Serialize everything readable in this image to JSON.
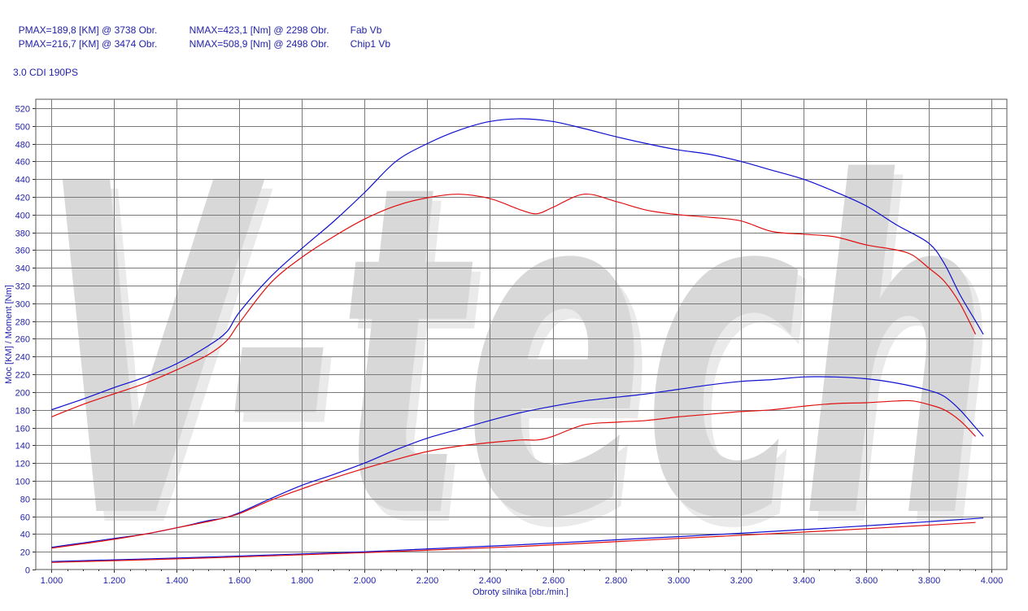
{
  "header": {
    "rows": [
      {
        "pmax": "PMAX=189,8 [KM] @ 3738 Obr.",
        "nmax": "NMAX=423,1 [Nm] @ 2298 Obr.",
        "name": "Fab Vb"
      },
      {
        "pmax": "PMAX=216,7 [KM] @ 3474 Obr.",
        "nmax": "NMAX=508,9 [Nm] @ 2498 Obr.",
        "name": "Chip1 Vb"
      }
    ],
    "title": "3.0 CDI 190PS"
  },
  "watermark": {
    "text": "V-tech"
  },
  "colors": {
    "fab": "#e01010",
    "chip": "#1010d0",
    "grid": "#7a7a7a",
    "text": "#1f1fa8"
  },
  "chart_data": {
    "type": "line",
    "xlabel": "Obroty silnika [obr./min.]",
    "ylabel": "Moc [KM] / Moment [Nm]",
    "xlim": [
      950,
      4050
    ],
    "ylim": [
      0,
      530
    ],
    "x_ticks": [
      1000,
      1200,
      1400,
      1600,
      1800,
      2000,
      2200,
      2400,
      2600,
      2800,
      3000,
      3200,
      3400,
      3600,
      3800,
      4000
    ],
    "x_tick_labels": [
      "1.000",
      "1.200",
      "1.400",
      "1.600",
      "1.800",
      "2.000",
      "2.200",
      "2.400",
      "2.600",
      "2.800",
      "3.000",
      "3.200",
      "3.400",
      "3.600",
      "3.800",
      "4.000"
    ],
    "y_ticks": [
      0,
      20,
      40,
      60,
      80,
      100,
      120,
      140,
      160,
      180,
      200,
      220,
      240,
      260,
      280,
      300,
      320,
      340,
      360,
      380,
      400,
      420,
      440,
      460,
      480,
      500,
      520
    ],
    "grid": true,
    "series": [
      {
        "name": "Chip1 Vb",
        "quantity": "torque",
        "color": "#1010d0",
        "x": [
          1000,
          1100,
          1200,
          1300,
          1400,
          1500,
          1560,
          1600,
          1700,
          1800,
          1900,
          2000,
          2100,
          2200,
          2300,
          2400,
          2500,
          2600,
          2700,
          2800,
          2900,
          3000,
          3100,
          3200,
          3300,
          3400,
          3500,
          3600,
          3700,
          3800,
          3850,
          3900,
          3950,
          3975
        ],
        "y": [
          180,
          192,
          205,
          217,
          232,
          252,
          268,
          290,
          330,
          362,
          392,
          425,
          460,
          480,
          495,
          505,
          508,
          505,
          497,
          488,
          480,
          473,
          468,
          460,
          450,
          440,
          426,
          410,
          388,
          368,
          345,
          310,
          280,
          265
        ]
      },
      {
        "name": "Fab Vb",
        "quantity": "torque",
        "color": "#e01010",
        "x": [
          1000,
          1100,
          1200,
          1300,
          1400,
          1500,
          1560,
          1600,
          1700,
          1800,
          1900,
          2000,
          2100,
          2200,
          2300,
          2400,
          2500,
          2550,
          2600,
          2700,
          2800,
          2900,
          3000,
          3100,
          3200,
          3300,
          3400,
          3500,
          3600,
          3700,
          3750,
          3800,
          3850,
          3900,
          3950
        ],
        "y": [
          172,
          186,
          198,
          210,
          225,
          242,
          258,
          278,
          323,
          352,
          375,
          395,
          410,
          419,
          423,
          418,
          405,
          401,
          408,
          423,
          415,
          405,
          400,
          397,
          393,
          381,
          378,
          375,
          366,
          360,
          354,
          340,
          325,
          300,
          265
        ]
      },
      {
        "name": "Chip1 Vb",
        "quantity": "power",
        "color": "#1010d0",
        "x": [
          1000,
          1100,
          1200,
          1300,
          1400,
          1500,
          1550,
          1600,
          1700,
          1800,
          1900,
          2000,
          2100,
          2200,
          2300,
          2400,
          2500,
          2600,
          2700,
          2800,
          2900,
          3000,
          3100,
          3200,
          3300,
          3400,
          3500,
          3600,
          3700,
          3800,
          3850,
          3900,
          3950,
          3975
        ],
        "y": [
          25,
          30,
          35,
          40,
          47,
          55,
          58,
          64,
          80,
          95,
          107,
          120,
          135,
          148,
          158,
          168,
          177,
          184,
          190,
          194,
          198,
          203,
          208,
          212,
          214,
          217,
          217,
          215,
          210,
          202,
          195,
          180,
          160,
          150
        ]
      },
      {
        "name": "Fab Vb",
        "quantity": "power",
        "color": "#e01010",
        "x": [
          1000,
          1100,
          1200,
          1300,
          1400,
          1500,
          1550,
          1600,
          1700,
          1800,
          1900,
          2000,
          2100,
          2200,
          2300,
          2400,
          2500,
          2550,
          2600,
          2700,
          2800,
          2900,
          3000,
          3100,
          3200,
          3300,
          3400,
          3500,
          3600,
          3700,
          3750,
          3800,
          3850,
          3900,
          3950
        ],
        "y": [
          24,
          29,
          34,
          40,
          47,
          54,
          58,
          63,
          78,
          91,
          103,
          114,
          124,
          133,
          139,
          143,
          146,
          146,
          150,
          163,
          166,
          168,
          172,
          175,
          178,
          180,
          184,
          187,
          188,
          190,
          190,
          186,
          180,
          168,
          150
        ]
      },
      {
        "name": "Chip1 Vb",
        "quantity": "loss",
        "color": "#1010d0",
        "x": [
          1000,
          1500,
          2000,
          2500,
          3000,
          3500,
          3975
        ],
        "y": [
          9,
          14,
          20,
          28,
          37,
          47,
          58
        ]
      },
      {
        "name": "Fab Vb",
        "quantity": "loss",
        "color": "#e01010",
        "x": [
          1000,
          1500,
          2000,
          2500,
          3000,
          3500,
          3950
        ],
        "y": [
          8,
          13,
          19,
          26,
          35,
          44,
          53
        ]
      }
    ]
  }
}
